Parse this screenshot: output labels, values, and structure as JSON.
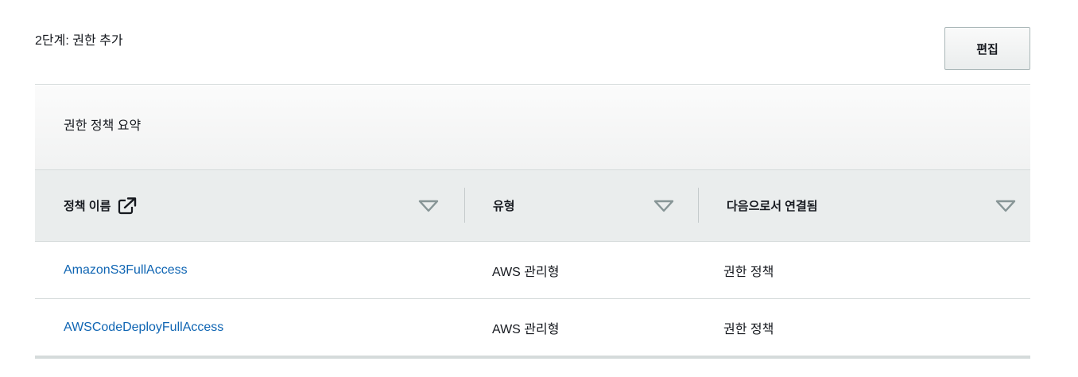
{
  "step": {
    "title": "2단계: 권한 추가",
    "edit_label": "편집"
  },
  "summary": {
    "title": "권한 정책 요약",
    "columns": [
      {
        "label": "정책 이름",
        "has_external_icon": true,
        "icon": "external-link-icon"
      },
      {
        "label": "유형"
      },
      {
        "label": "다음으로서 연결됨"
      }
    ],
    "sort_icon": "sort-down-triangle-icon",
    "rows": [
      {
        "policy_name": "AmazonS3FullAccess",
        "type": "AWS 관리형",
        "attached_as": "권한 정책"
      },
      {
        "policy_name": "AWSCodeDeployFullAccess",
        "type": "AWS 관리형",
        "attached_as": "권한 정책"
      }
    ]
  },
  "colors": {
    "link": "#0f65b3",
    "header_bg": "#eaeded",
    "border": "#d5dbdb",
    "sort_icon": "#879596"
  }
}
